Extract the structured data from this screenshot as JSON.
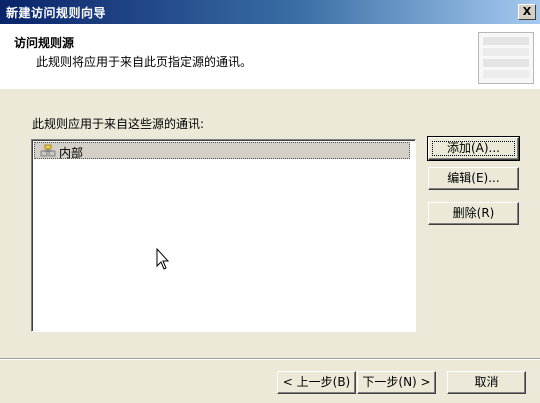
{
  "window": {
    "title": "新建访问规则向导",
    "close_label": "X"
  },
  "header": {
    "title": "访问规则源",
    "description": "此规则将应用于来自此页指定源的通讯。"
  },
  "main": {
    "list_label": "此规则应用于来自这些源的通讯:",
    "items": [
      {
        "label": "内部",
        "icon": "network-icon",
        "selected": true
      }
    ]
  },
  "side_buttons": {
    "add": "添加(A)...",
    "edit": "编辑(E)...",
    "delete": "删除(R)"
  },
  "footer": {
    "back": "< 上一步(B)",
    "next": "下一步(N) >",
    "cancel": "取消"
  }
}
